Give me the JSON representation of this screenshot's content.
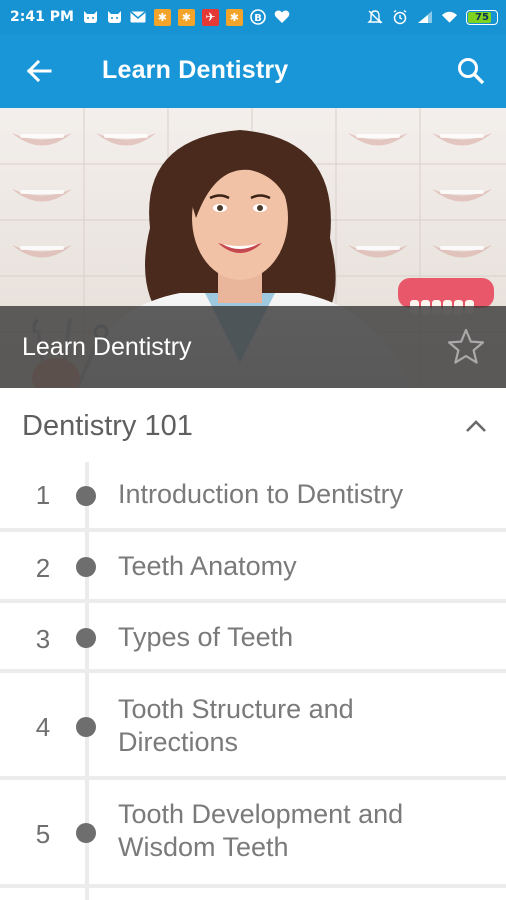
{
  "status_bar": {
    "time": "2:41 PM",
    "battery_level": "75",
    "icons": [
      "cat-icon",
      "cat-icon",
      "mail-icon",
      "app-icon",
      "app-icon",
      "app-icon",
      "app-icon",
      "b-icon",
      "heart-icon",
      "mute-icon",
      "alarm-icon",
      "signal-icon",
      "wifi-icon",
      "battery-icon"
    ]
  },
  "app_bar": {
    "title": "Learn Dentistry",
    "back_icon": "arrow-left-icon",
    "search_icon": "search-icon"
  },
  "hero": {
    "title": "Learn Dentistry",
    "favorite_icon": "star-outline-icon"
  },
  "section": {
    "title": "Dentistry 101",
    "expanded": true
  },
  "lessons": [
    {
      "number": "1",
      "title": "Introduction to Dentistry"
    },
    {
      "number": "2",
      "title": "Teeth Anatomy"
    },
    {
      "number": "3",
      "title": "Types of Teeth"
    },
    {
      "number": "4",
      "title": "Tooth Structure and Directions"
    },
    {
      "number": "5",
      "title": "Tooth Development and Wisdom Teeth"
    }
  ],
  "colors": {
    "status_bar": "#1792d3",
    "app_bar": "#1996d8",
    "text_gray": "#7a7a7a",
    "dot": "#6e6e6e"
  }
}
